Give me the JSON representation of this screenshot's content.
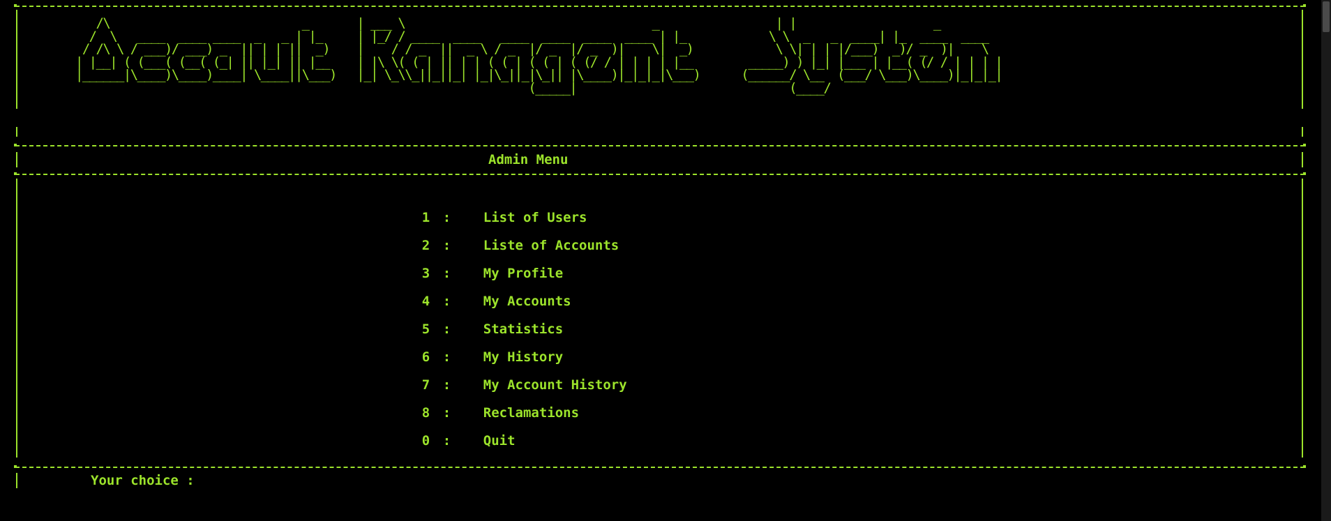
{
  "banner": {
    "ascii_art": "   /\\                            _       | ___ \\                                    _                 | |                    _\n  /  \\   ____  ____ ____  _   _ | |_     | |_/ / ____  ____   ____  ____  ____  ____ | |_            \\ \\  _   _  ____| |_  ____  ____\n / /\\ \\ / ___)/ ___) _  || | | ||  _)    |    / / _  ||  _ \\ / _  |/ _  |/ _  )|    \\|  _)            \\ \\| | | |/___)  _)/ _  )|    \\\n| |__| ( (___( (__( (_| || |_| || |__    | |\\ \\( ( | || | | ( ( | ( ( | ( (/ / | | | | |__        _____) ) |_| |___ | |__( (/ / | | | |\n|______|\\____)\\____)____| \\____||\\___)   |_| \\_\\\\_||_||_| |_|\\_||_|\\_|| |\\____)|_|_|_|\\___)      (______/ \\__  (___/ \\___)\\____)|_|_|_|\n                                                                  (_____|                               (____/"
  },
  "menu": {
    "title": "Admin Menu",
    "items": [
      {
        "key": "1",
        "sep": ":",
        "label": "List of Users"
      },
      {
        "key": "2",
        "sep": ":",
        "label": "Liste of Accounts"
      },
      {
        "key": "3",
        "sep": ":",
        "label": "My Profile"
      },
      {
        "key": "4",
        "sep": ":",
        "label": "My Accounts"
      },
      {
        "key": "5",
        "sep": ":",
        "label": "Statistics"
      },
      {
        "key": "6",
        "sep": ":",
        "label": "My History"
      },
      {
        "key": "7",
        "sep": ":",
        "label": "My Account History"
      },
      {
        "key": "8",
        "sep": ":",
        "label": "Reclamations"
      },
      {
        "key": "0",
        "sep": ":",
        "label": "Quit"
      }
    ]
  },
  "prompt": {
    "text": "Your choice :"
  },
  "colors": {
    "background": "#000000",
    "foreground": "#9ce32b"
  }
}
